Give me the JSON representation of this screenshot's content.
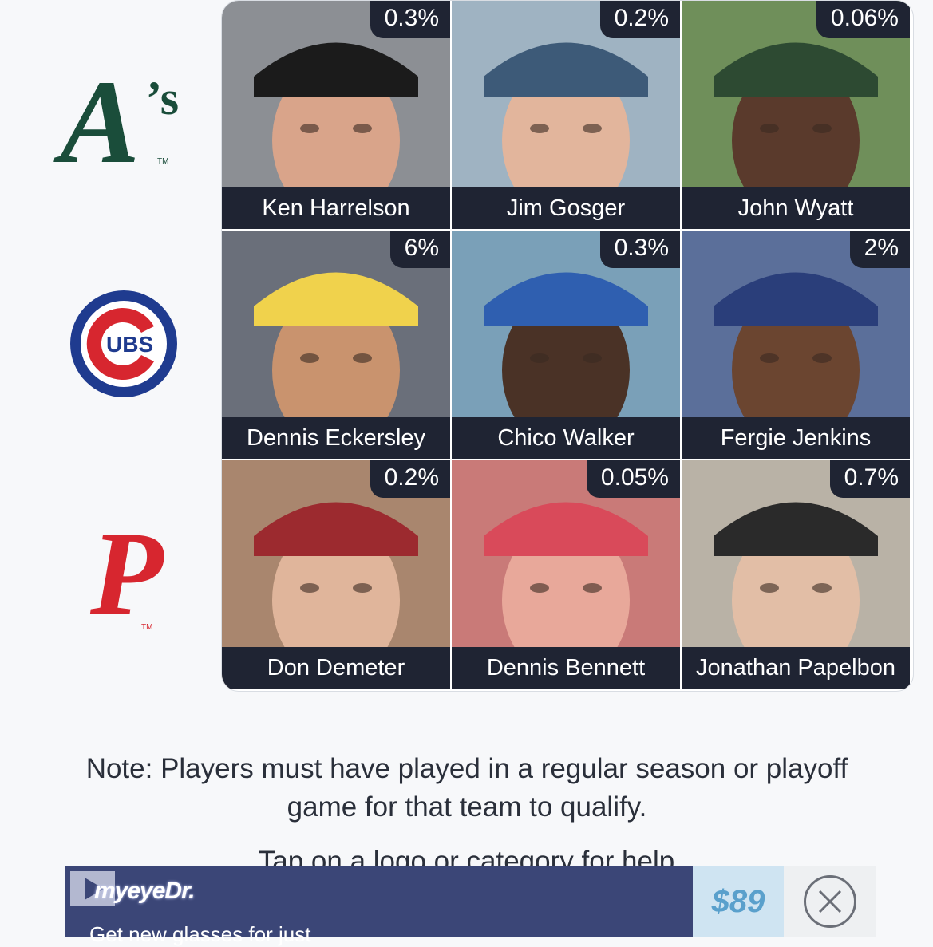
{
  "rows": [
    {
      "team_icon": "athletics-logo-icon",
      "logo_text": "A's",
      "color": "#1a4d3a"
    },
    {
      "team_icon": "cubs-logo-icon",
      "logo_text": "UBS",
      "color": "#1f3b8f"
    },
    {
      "team_icon": "phillies-logo-icon",
      "logo_text": "P",
      "color": "#d7262f"
    }
  ],
  "cells": [
    {
      "percent": "0.3%",
      "name": "Ken Harrelson"
    },
    {
      "percent": "0.2%",
      "name": "Jim Gosger"
    },
    {
      "percent": "0.06%",
      "name": "John Wyatt"
    },
    {
      "percent": "6%",
      "name": "Dennis Eckersley"
    },
    {
      "percent": "0.3%",
      "name": "Chico Walker"
    },
    {
      "percent": "2%",
      "name": "Fergie Jenkins"
    },
    {
      "percent": "0.2%",
      "name": "Don Demeter"
    },
    {
      "percent": "0.05%",
      "name": "Dennis Bennett"
    },
    {
      "percent": "0.7%",
      "name": "Jonathan Papelbon"
    }
  ],
  "note": "Note: Players must have played in a regular season or playoff game for that team to qualify.",
  "help_text": "Tap on a logo or category for help",
  "ad": {
    "brand": "myeyeDr.",
    "tagline": "Get new glasses for just",
    "price": "$89"
  },
  "colors": {
    "label_bg": "#1f2433",
    "page_bg": "#f7f8fa",
    "ad_bg": "#3b4677"
  }
}
